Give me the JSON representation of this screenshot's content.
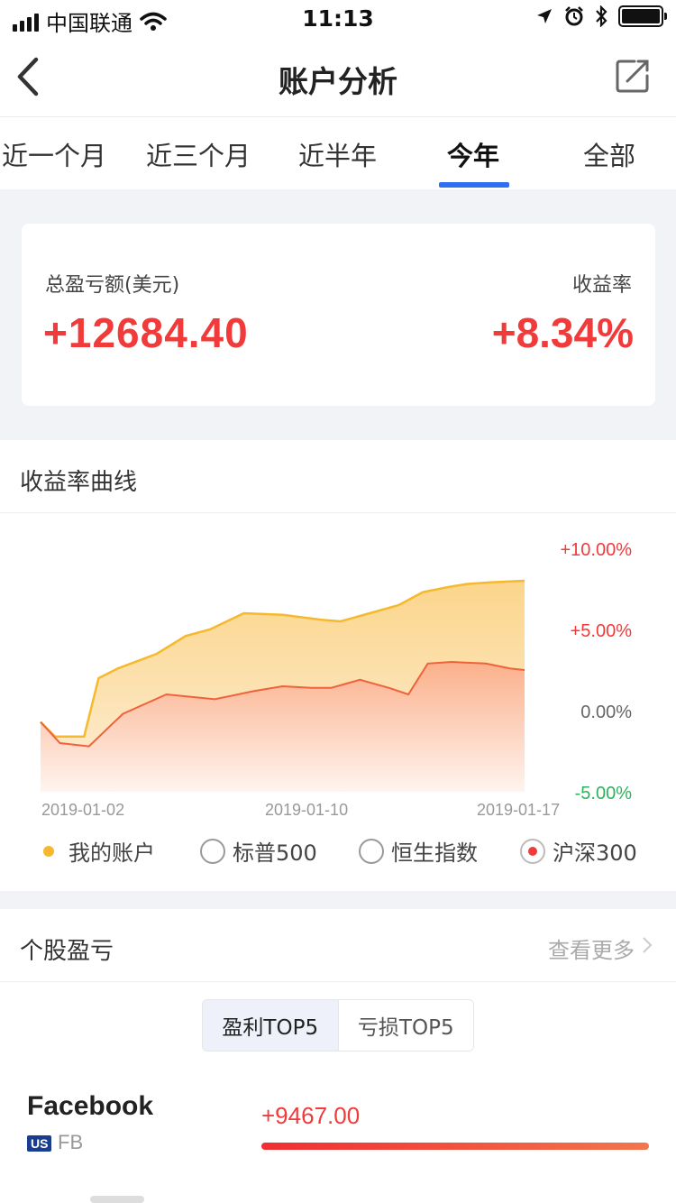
{
  "status_bar": {
    "carrier": "中国联通",
    "time": "11:13"
  },
  "nav": {
    "title": "账户分析"
  },
  "tabs": [
    {
      "label": "近一个月",
      "active": false
    },
    {
      "label": "近三个月",
      "active": false
    },
    {
      "label": "近半年",
      "active": false
    },
    {
      "label": "今年",
      "active": true
    },
    {
      "label": "全部",
      "active": false
    }
  ],
  "summary": {
    "total_label": "总盈亏额(美元)",
    "total_value": "+12684.40",
    "rate_label": "收益率",
    "rate_value": "+8.34%"
  },
  "chart_section": {
    "title": "收益率曲线",
    "legend": [
      {
        "label": "我的账户",
        "kind": "dot",
        "selected": true
      },
      {
        "label": "标普500",
        "kind": "radio",
        "selected": false
      },
      {
        "label": "恒生指数",
        "kind": "radio",
        "selected": false
      },
      {
        "label": "沪深300",
        "kind": "radio",
        "selected": true
      }
    ]
  },
  "chart_data": {
    "type": "area",
    "x_tick_labels": [
      "2019-01-02",
      "2019-01-10",
      "2019-01-17"
    ],
    "y_tick_labels": [
      "+10.00%",
      "+5.00%",
      "0.00%",
      "-5.00%"
    ],
    "y_ticks": [
      10,
      5,
      0,
      -5
    ],
    "ylim": [
      -5,
      10
    ],
    "grid": false,
    "colors": {
      "my_account": "#f6b92e",
      "csi300": "#f0623a",
      "positive_tick": "#f23a3a",
      "neutral_tick": "#666666",
      "negative_tick": "#2db35d"
    },
    "series": [
      {
        "name": "我的账户",
        "x": [
          0,
          0.03,
          0.09,
          0.12,
          0.16,
          0.24,
          0.3,
          0.35,
          0.42,
          0.5,
          0.58,
          0.62,
          0.68,
          0.74,
          0.79,
          0.84,
          0.88,
          0.93,
          1.0
        ],
        "values": [
          -0.7,
          -1.6,
          -1.6,
          2.0,
          2.6,
          3.5,
          4.6,
          5.0,
          6.0,
          5.9,
          5.6,
          5.5,
          6.0,
          6.5,
          7.3,
          7.6,
          7.8,
          7.9,
          8.0
        ]
      },
      {
        "name": "沪深300",
        "x": [
          0,
          0.04,
          0.1,
          0.17,
          0.26,
          0.36,
          0.44,
          0.5,
          0.56,
          0.6,
          0.66,
          0.72,
          0.76,
          0.8,
          0.85,
          0.92,
          0.97,
          1.0
        ],
        "values": [
          -0.7,
          -2.0,
          -2.2,
          -0.2,
          1.0,
          0.7,
          1.2,
          1.5,
          1.4,
          1.4,
          1.9,
          1.4,
          1.0,
          2.9,
          3.0,
          2.9,
          2.6,
          2.5
        ]
      }
    ]
  },
  "pl_section": {
    "title": "个股盈亏",
    "more_label": "查看更多",
    "segments": [
      {
        "label": "盈利TOP5",
        "active": true
      },
      {
        "label": "亏损TOP5",
        "active": false
      }
    ],
    "stocks": [
      {
        "name": "Facebook",
        "market": "US",
        "code": "FB",
        "value": "+9467.00",
        "bar_fraction": 1.0
      }
    ]
  }
}
